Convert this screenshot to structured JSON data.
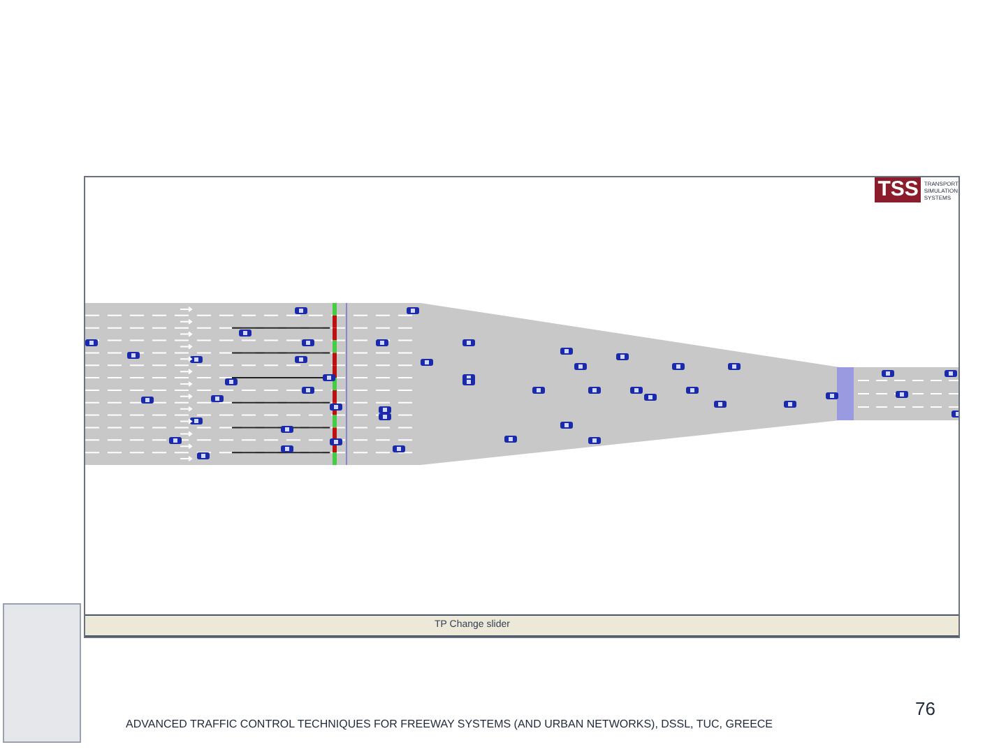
{
  "simulator": {
    "logo": {
      "mark": "TSS",
      "lines": [
        "TRANSPORT",
        "SIMULATION",
        "SYSTEMS"
      ]
    },
    "status_bar": "TP Change slider"
  },
  "footer": {
    "text": "ADVANCED TRAFFIC CONTROL TECHNIQUES FOR FREEWAY SYSTEMS (AND URBAN NETWORKS), DSSL, TUC, GREECE",
    "page_number": "76"
  }
}
